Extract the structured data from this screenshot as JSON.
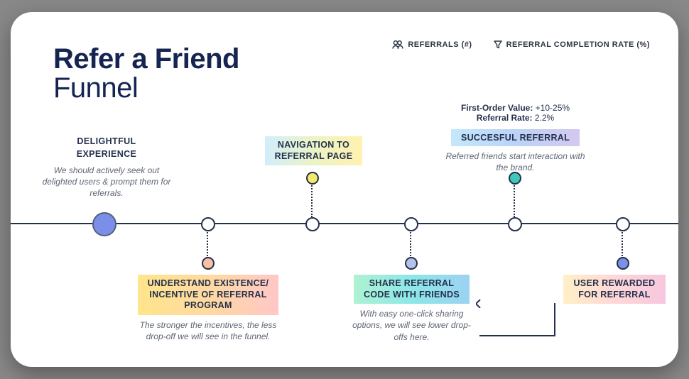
{
  "title_line1": "Refer a Friend",
  "title_line2": "Funnel",
  "legend": {
    "referrals": "REFERRALS (#)",
    "completion": "REFERRAL COMPLETION RATE (%)"
  },
  "stats": {
    "fov_label": "First-Order Value:",
    "fov_value": "+10-25%",
    "rr_label": "Referral Rate:",
    "rr_value": "2.2%"
  },
  "steps": {
    "delight": {
      "head": "DELIGHTFUL\nEXPERIENCE",
      "cap": "We should actively seek out delighted users & prompt them for referrals."
    },
    "understand": {
      "chip": "UNDERSTAND EXISTENCE/\nINCENTIVE OF REFERRAL\nPROGRAM",
      "cap": "The stronger the incentives, the less drop-off we will see in the funnel."
    },
    "nav": {
      "chip": "NAVIGATION TO\nREFERRAL PAGE"
    },
    "share": {
      "chip": "SHARE REFERRAL\nCODE WITH FRIENDS",
      "cap": "With easy one-click sharing options, we will see lower drop-offs here."
    },
    "success": {
      "chip": "SUCCESFUL REFERRAL",
      "cap": "Referred friends start interaction with the brand."
    },
    "reward": {
      "chip": "USER REWARDED\nFOR REFERRAL"
    }
  }
}
